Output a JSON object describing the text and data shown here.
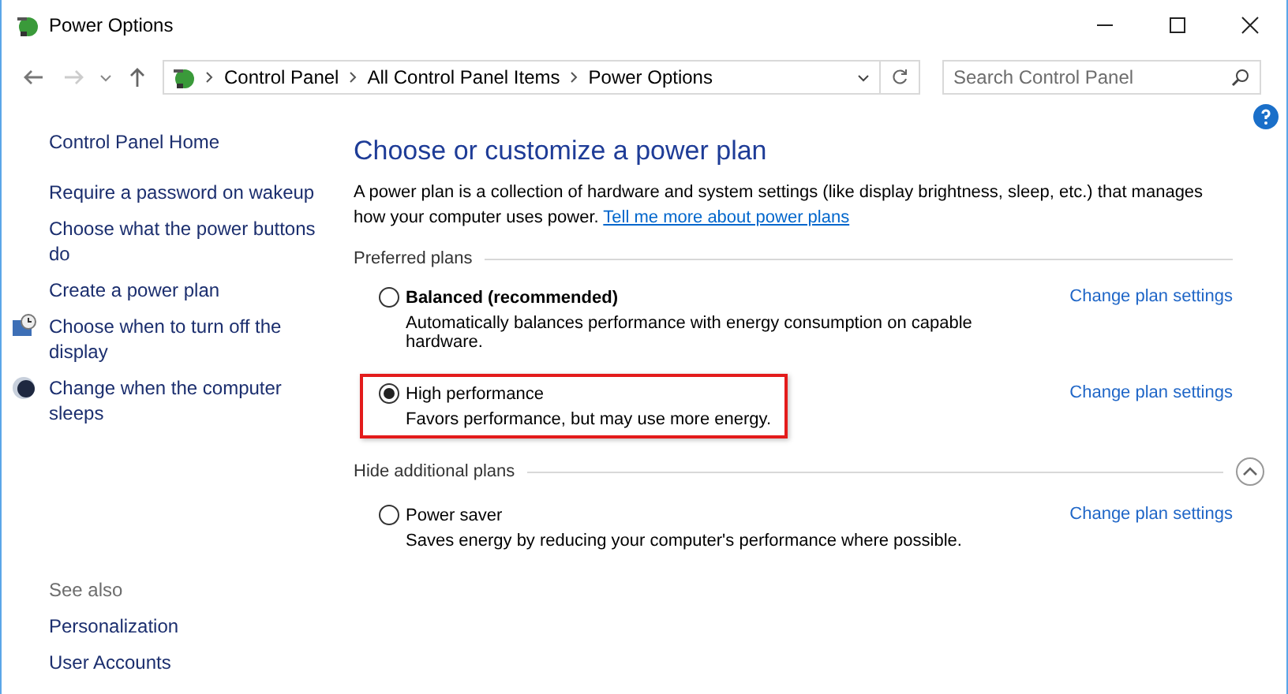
{
  "window": {
    "title": "Power Options"
  },
  "address_bar": {
    "breadcrumbs": [
      "Control Panel",
      "All Control Panel Items",
      "Power Options"
    ]
  },
  "search": {
    "placeholder": "Search Control Panel"
  },
  "sidebar": {
    "home": "Control Panel Home",
    "items": [
      {
        "label": "Require a password on wakeup",
        "kind": "plain"
      },
      {
        "label": "Choose what the power buttons do",
        "kind": "plain"
      },
      {
        "label": "Create a power plan",
        "kind": "plain"
      },
      {
        "label": "Choose when to turn off the display",
        "kind": "display"
      },
      {
        "label": "Change when the computer sleeps",
        "kind": "sleep"
      }
    ],
    "see_also": {
      "heading": "See also",
      "links": [
        "Personalization",
        "User Accounts"
      ]
    }
  },
  "main": {
    "heading": "Choose or customize a power plan",
    "description": "A power plan is a collection of hardware and system settings (like display brightness, sleep, etc.) that manages how your computer uses power.",
    "link": "Tell me more about power plans",
    "sections": [
      {
        "title": "Preferred plans",
        "kind": "plain",
        "plans": [
          {
            "name": "Balanced (recommended)",
            "bold": true,
            "selected": false,
            "highlighted": false,
            "description": "Automatically balances performance with energy consumption on capable hardware.",
            "link": "Change plan settings"
          },
          {
            "name": "High performance",
            "bold": false,
            "selected": true,
            "highlighted": true,
            "description": "Favors performance, but may use more energy.",
            "link": "Change plan settings"
          }
        ]
      },
      {
        "title": "Hide additional plans",
        "kind": "collapsible",
        "expanded": true,
        "plans": [
          {
            "name": "Power saver",
            "bold": false,
            "selected": false,
            "highlighted": false,
            "description": "Saves energy by reducing your computer's performance where possible.",
            "link": "Change plan settings"
          }
        ]
      }
    ]
  }
}
